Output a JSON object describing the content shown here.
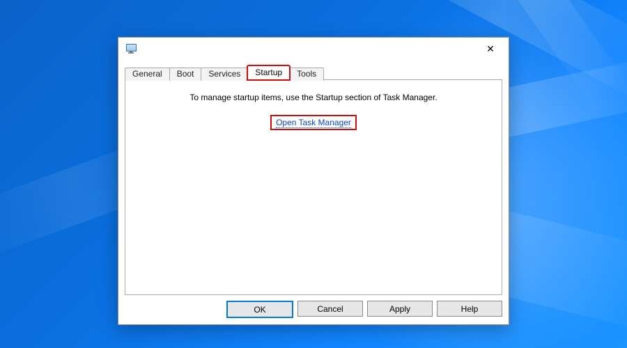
{
  "tabs": {
    "general": "General",
    "boot": "Boot",
    "services": "Services",
    "startup": "Startup",
    "tools": "Tools",
    "active": "startup"
  },
  "content": {
    "info_text": "To manage startup items, use the Startup section of Task Manager.",
    "open_link": "Open Task Manager"
  },
  "buttons": {
    "ok": "OK",
    "cancel": "Cancel",
    "apply": "Apply",
    "help": "Help"
  }
}
